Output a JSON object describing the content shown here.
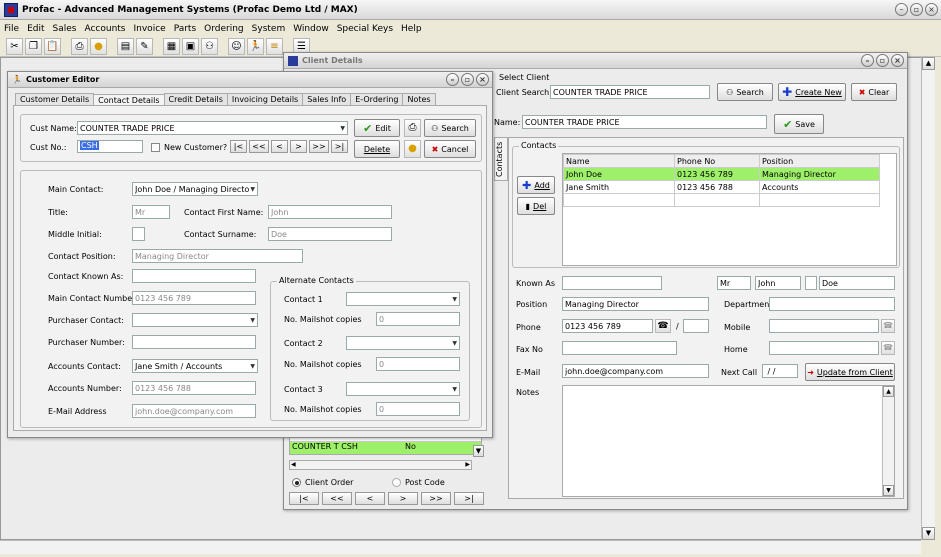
{
  "app_title": "Profac - Advanced Management Systems (Profac Demo Ltd / MAX)",
  "menu": [
    "File",
    "Edit",
    "Sales",
    "Accounts",
    "Invoice",
    "Parts",
    "Ordering",
    "System",
    "Window",
    "Special Keys",
    "Help"
  ],
  "toolbar_icons": [
    "cut-icon",
    "copy-icon",
    "paste-icon",
    "print-icon",
    "bulb-icon",
    "page-icon",
    "edit-icon",
    "report-icon",
    "calc-icon",
    "binoculars-icon",
    "search-people-icon",
    "run-icon",
    "stack-icon",
    "list-icon"
  ],
  "client_win": {
    "title": "Client Details",
    "select_client": "Select Client",
    "client_search_label": "Client Search:",
    "client_search_value": "COUNTER TRADE PRICE",
    "search_btn": "Search",
    "create_new_btn": "Create New",
    "clear_btn": "Clear",
    "name_label": "Name:",
    "name_value": "COUNTER TRADE PRICE",
    "save_btn": "Save",
    "contacts_tab": "Contacts",
    "contacts_group": "Contacts",
    "add_btn": "Add",
    "del_btn": "Del",
    "cols": [
      "Name",
      "Phone No",
      "Position"
    ],
    "rows": [
      [
        "John Doe",
        "0123 456 789",
        "Managing Director"
      ],
      [
        "Jane Smith",
        "0123 456 788",
        "Accounts"
      ]
    ],
    "known_as_label": "Known As",
    "title_val": "Mr",
    "first_val": "John",
    "last_val": "Doe",
    "position_label": "Position",
    "position_val": "Managing Director",
    "department_label": "Department",
    "phone_label": "Phone",
    "phone_val": "0123 456 789",
    "phone_sep": "/",
    "mobile_label": "Mobile",
    "fax_label": "Fax No",
    "home_label": "Home",
    "email_label": "E-Mail",
    "email_val": "john.doe@company.com",
    "next_call_label": "Next Call",
    "next_call_val": " / /",
    "update_btn": "Update from Client",
    "notes_label": "Notes",
    "list_row_partial": "COUNTER T CSH",
    "list_row_partial_val": "No",
    "radio_client_order": "Client Order",
    "radio_post_code": "Post Code",
    "nav": [
      "|<",
      "<<",
      "<",
      ">",
      ">>",
      ">|"
    ]
  },
  "cust_win": {
    "title": "Customer Editor",
    "tabs": [
      "Customer Details",
      "Contact Details",
      "Credit Details",
      "Invoicing Details",
      "Sales Info",
      "E-Ordering",
      "Notes"
    ],
    "cust_name_label": "Cust Name:",
    "cust_name_value": "COUNTER TRADE PRICE",
    "edit_btn": "Edit",
    "search_btn": "Search",
    "cust_no_label": "Cust No.:",
    "cust_no_value": "CSH",
    "new_customer_label": "New Customer?",
    "nav": [
      "|<",
      "<<",
      "<",
      ">",
      ">>",
      ">|"
    ],
    "delete_btn": "Delete",
    "cancel_btn": "Cancel",
    "main_contact_label": "Main Contact:",
    "main_contact_val": "John Doe / Managing Director",
    "title_label": "Title:",
    "title_val": "Mr",
    "first_name_label": "Contact First Name:",
    "first_name_val": "John",
    "middle_label": "Middle Initial:",
    "surname_label": "Contact Surname:",
    "surname_val": "Doe",
    "position_label": "Contact Position:",
    "position_val": "Managing Director",
    "known_as_label": "Contact Known As:",
    "main_number_label": "Main Contact Number:",
    "main_number_val": "0123 456 789",
    "purchaser_contact_label": "Purchaser Contact:",
    "purchaser_number_label": "Purchaser Number:",
    "accounts_contact_label": "Accounts Contact:",
    "accounts_contact_val": "Jane Smith / Accounts",
    "accounts_number_label": "Accounts Number:",
    "accounts_number_val": "0123 456 788",
    "email_label": "E-Mail Address",
    "email_val": "john.doe@company.com",
    "alt_group": "Alternate Contacts",
    "contact1": "Contact 1",
    "contact2": "Contact 2",
    "contact3": "Contact 3",
    "mailshot_label": "No. Mailshot copies",
    "mailshot_val": "0"
  }
}
